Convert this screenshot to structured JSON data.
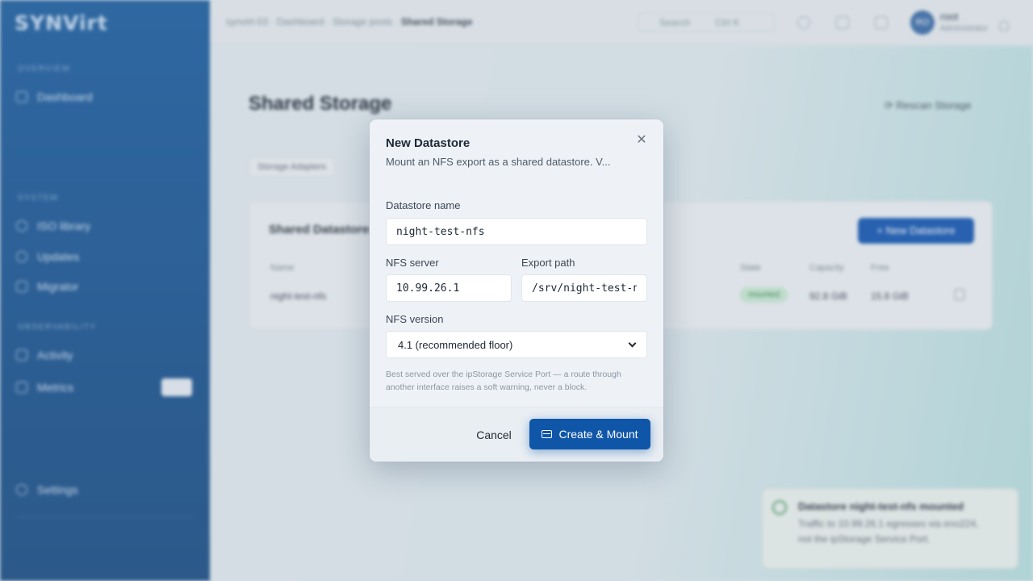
{
  "app": {
    "logo": "SYNVirt"
  },
  "sidebar": {
    "sections": [
      "OVERVIEW",
      "SYSTEM",
      "OBSERVABILITY"
    ],
    "items": [
      {
        "label": "Dashboard",
        "icon": "grid-icon"
      },
      {
        "label": "ISO library",
        "icon": "disc-icon"
      },
      {
        "label": "Updates",
        "icon": "refresh-icon"
      },
      {
        "label": "Migrator",
        "icon": "arrows-icon"
      },
      {
        "label": "Activity",
        "icon": "activity-icon"
      },
      {
        "label": "Metrics",
        "icon": "chart-icon"
      },
      {
        "label": "Settings",
        "icon": "gear-icon"
      }
    ]
  },
  "topbar": {
    "breadcrumb": [
      "synvirt-03",
      "Dashboard",
      "Storage pools",
      "Shared Storage"
    ],
    "search_placeholder": "Search",
    "search_shortcut": "Ctrl K",
    "user_initials": "RO",
    "user_name": "root",
    "user_role": "Administrator"
  },
  "page": {
    "title": "Shared Storage",
    "rescan_label": "Rescan Storage",
    "tabs": [
      "Storage Adapters"
    ],
    "card_title": "Shared Datastores",
    "new_datastore_label": "New Datastore",
    "columns": [
      "Name",
      "State",
      "Capacity",
      "Free"
    ],
    "rows": [
      {
        "name": "night-test-nfs",
        "state": "mounted",
        "capacity": "92.8 GiB",
        "free": "15.8 GiB"
      }
    ]
  },
  "toast": {
    "title": "Datastore night-test-nfs mounted",
    "body": "Traffic to 10.99.26.1 egresses via eno224, not the ipStorage Service Port."
  },
  "modal": {
    "title": "New Datastore",
    "description": "Mount an NFS export as a shared datastore. V...",
    "name_label": "Datastore name",
    "name_value": "night-test-nfs",
    "server_label": "NFS server",
    "server_value": "10.99.26.1",
    "path_label": "Export path",
    "path_value": "/srv/night-test-nfs",
    "version_label": "NFS version",
    "version_value": "4.1 (recommended floor)",
    "hint": "Best served over the ipStorage Service Port — a route through another interface raises a soft warning, never a block.",
    "cancel_label": "Cancel",
    "submit_label": "Create & Mount"
  }
}
